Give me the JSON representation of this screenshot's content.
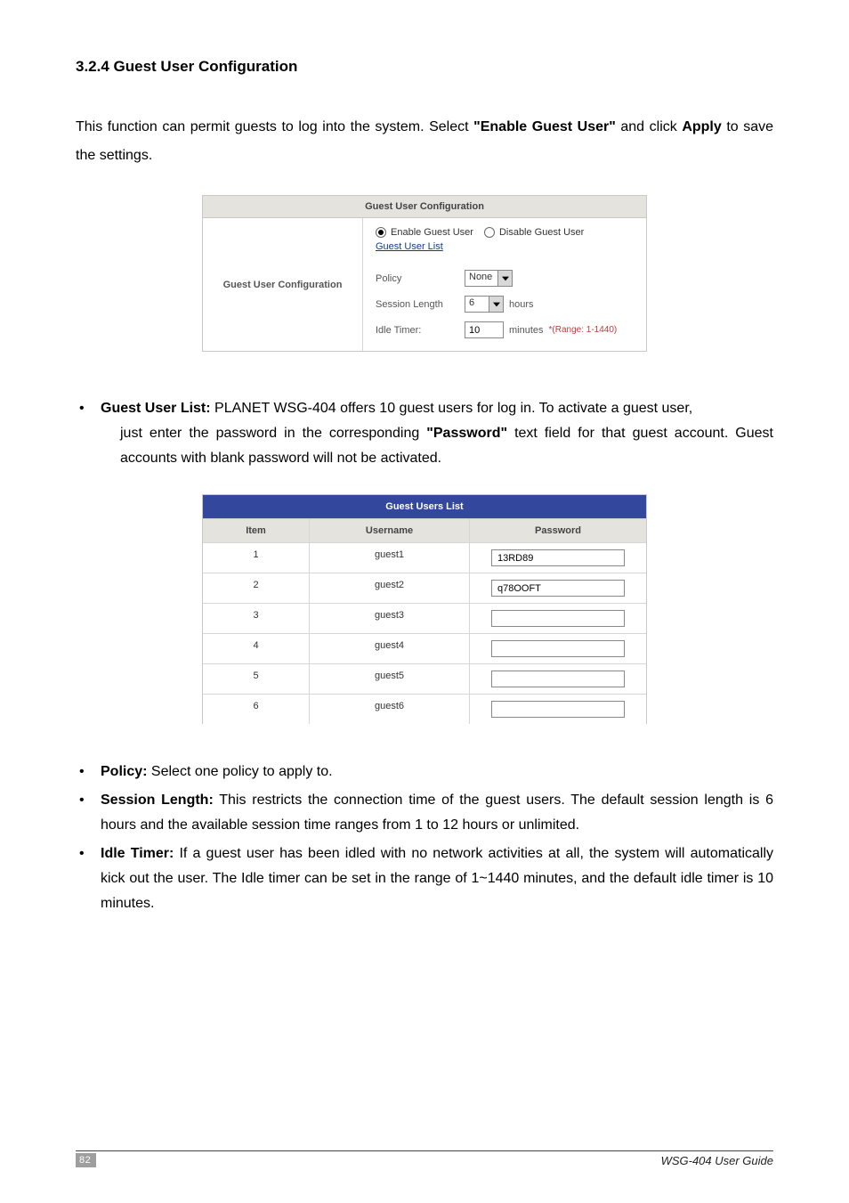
{
  "heading": "3.2.4 Guest User Configuration",
  "intro": {
    "pre": "This function can permit guests to log into the system. Select ",
    "bold1": "\"Enable Guest User\"",
    "mid": " and click ",
    "bold2": "Apply",
    "post": " to save the settings."
  },
  "fig1": {
    "title": "Guest User Configuration",
    "left_label": "Guest User Configuration",
    "radio_enable": "Enable Guest User",
    "radio_disable": "Disable Guest User",
    "link": "Guest User List",
    "policy_label": "Policy",
    "policy_value": "None",
    "session_label": "Session Length",
    "session_value": "6",
    "session_suffix": "hours",
    "idle_label": "Idle Timer:",
    "idle_value": "10",
    "idle_suffix": "minutes",
    "idle_range": "*(Range: 1-1440)"
  },
  "bullet_gul": {
    "label": "Guest User List:",
    "line1": " PLANET WSG-404 offers 10 guest users for log in. To activate a guest user,",
    "line2a": "just enter the password in the corresponding ",
    "line2bold": "\"Password\"",
    "line2b": " text field for that guest account. Guest accounts with blank password will not be activated."
  },
  "fig2": {
    "title": "Guest Users List",
    "h_item": "Item",
    "h_username": "Username",
    "h_password": "Password",
    "rows": [
      {
        "item": "1",
        "username": "guest1",
        "password": "13RD89"
      },
      {
        "item": "2",
        "username": "guest2",
        "password": "q78OOFT"
      },
      {
        "item": "3",
        "username": "guest3",
        "password": ""
      },
      {
        "item": "4",
        "username": "guest4",
        "password": ""
      },
      {
        "item": "5",
        "username": "guest5",
        "password": ""
      },
      {
        "item": "6",
        "username": "guest6",
        "password": ""
      }
    ]
  },
  "bullet_policy": {
    "label": "Policy:",
    "text": " Select one policy to apply to."
  },
  "bullet_session": {
    "label": "Session Length:",
    "text": " This restricts the connection time of the guest users. The default session length is 6 hours and the available session time ranges from 1 to 12 hours or unlimited."
  },
  "bullet_idle": {
    "label": "Idle Timer:",
    "text": " If a guest user has been idled with no network activities at all, the system will automatically kick out the user. The Idle timer can be set in the range of 1~1440 minutes, and the default idle timer is 10 minutes."
  },
  "footer": {
    "page": "82",
    "guide": "WSG-404  User Guide"
  }
}
